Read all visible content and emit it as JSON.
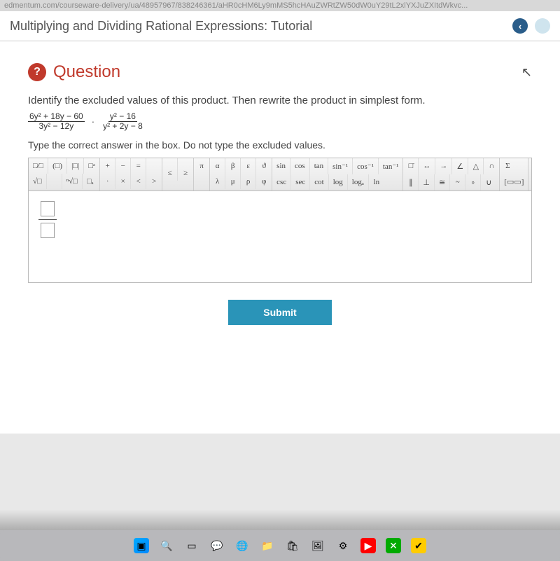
{
  "url": "edmentum.com/courseware-delivery/ua/48957967/838246361/aHR0cHM6Ly9mMS5hcHAuZWRtZW50dW0uY29tL2xlYXJuZXItdWkvc...",
  "page_title": "Multiplying and Dividing Rational Expressions: Tutorial",
  "question": {
    "icon_text": "?",
    "heading": "Question",
    "prompt": "Identify the excluded values of this product. Then rewrite the product in simplest form.",
    "expr": {
      "f1_num": "6y² + 18y − 60",
      "f1_den": "3y² − 12y",
      "dot": "·",
      "f2_num": "y² − 16",
      "f2_den": "y² + 2y − 8"
    },
    "instructions": "Type the correct answer in the box. Do not type the excluded values."
  },
  "toolbar": {
    "g1": {
      "r1": [
        "□⁄□",
        "(□)",
        "|□|",
        "□ᵃ"
      ],
      "r2": [
        "√□",
        "",
        "ⁿ√□",
        "□ₐ"
      ]
    },
    "g2": {
      "r1": [
        "+",
        "−",
        "=",
        ""
      ],
      "r2": [
        "·",
        "×",
        "<",
        ">"
      ]
    },
    "g3": {
      "r1": [
        "",
        "",
        "",
        ""
      ],
      "r2": [
        "≤",
        "≥",
        "",
        ""
      ]
    },
    "g4": {
      "r1": [
        "π"
      ],
      "r2": [
        ""
      ]
    },
    "g5": {
      "r1": [
        "α",
        "β",
        "ε",
        "ϑ"
      ],
      "r2": [
        "λ",
        "μ",
        "ρ",
        "φ"
      ]
    },
    "g6": {
      "r1": [
        "sin",
        "cos",
        "tan",
        "sin⁻¹",
        "cos⁻¹",
        "tan⁻¹"
      ],
      "r2": [
        "csc",
        "sec",
        "cot",
        "log",
        "logₐ",
        "ln"
      ]
    },
    "g7": {
      "r1": [
        "□̄",
        "↔",
        "→",
        "∠",
        "△",
        "∩"
      ],
      "r2": [
        "∥",
        "⊥",
        "≅",
        "~",
        "∘",
        "∪"
      ]
    },
    "g8": {
      "r1": [
        "Σ"
      ],
      "r2": [
        "[▭▭]"
      ]
    }
  },
  "submit_label": "Submit",
  "taskbar_icons": [
    "start",
    "search",
    "task",
    "chat",
    "edge",
    "files",
    "store",
    "photos",
    "settings",
    "youtube",
    "xbox",
    "norton"
  ]
}
